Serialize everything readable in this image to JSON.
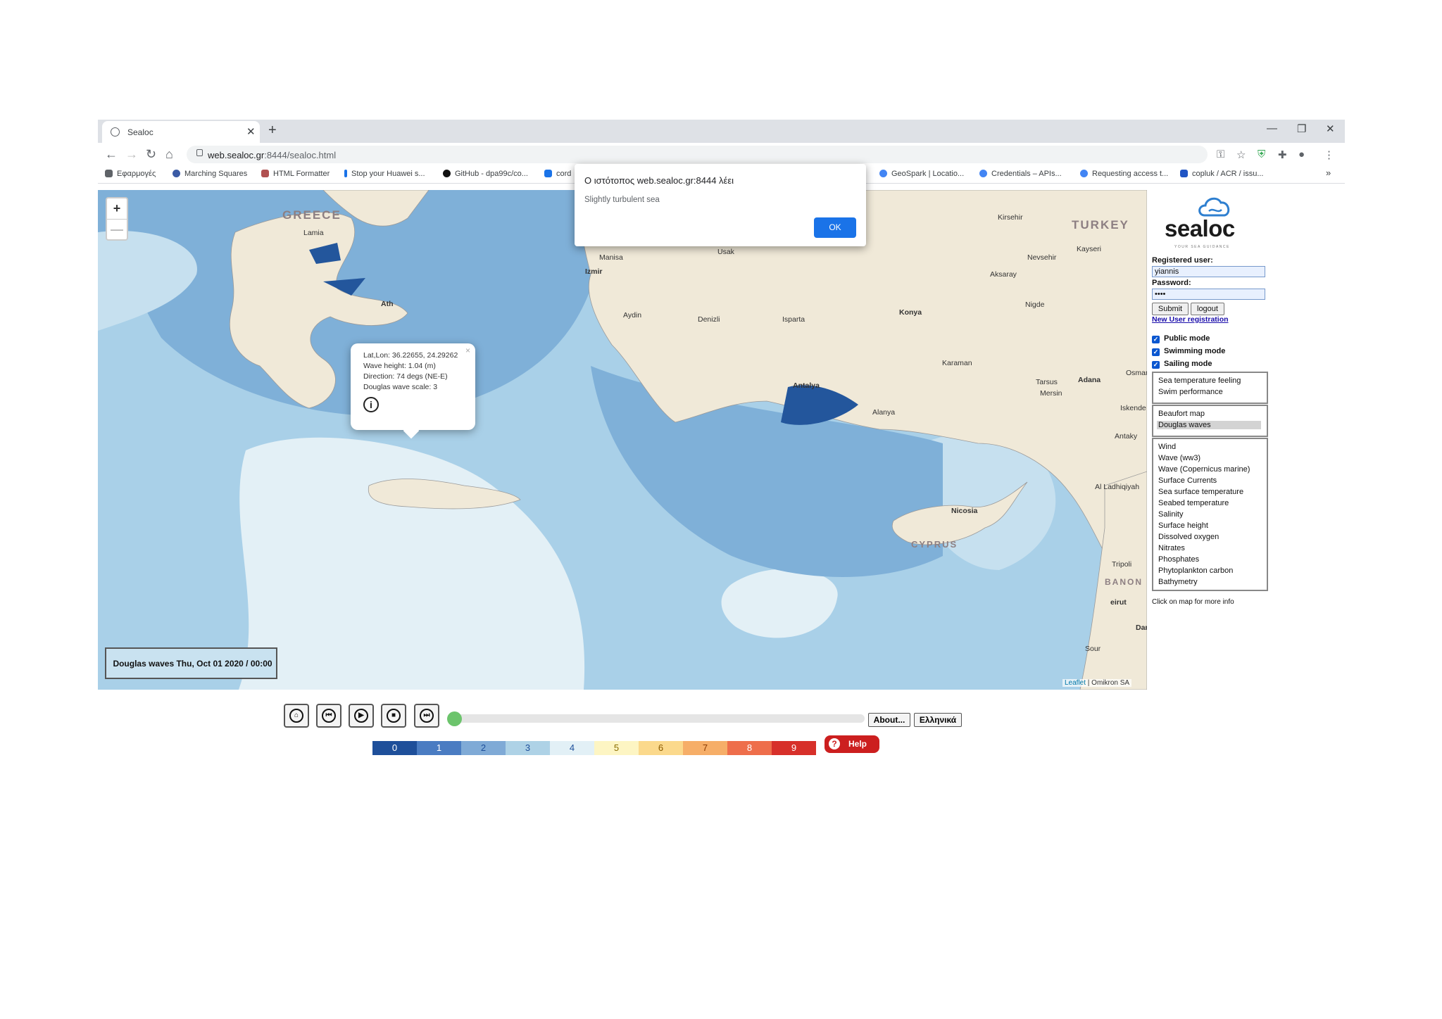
{
  "browser": {
    "tab_title": "Sealoc",
    "url_host": "web.sealoc.gr",
    "url_path": ":8444/sealoc.html",
    "bookmarks": [
      {
        "label": "Εφαρμογές",
        "color": "#5f6368"
      },
      {
        "label": "Marching Squares",
        "color": "#3b5ba5"
      },
      {
        "label": "HTML Formatter",
        "color": "#b05050"
      },
      {
        "label": "Stop your Huawei s...",
        "color": "#1a73e8"
      },
      {
        "label": "GitHub - dpa99c/co...",
        "color": "#111111"
      },
      {
        "label": "cord",
        "color": "#1a73e8"
      },
      {
        "label": "GeoSpark | Locatio...",
        "color": "#4285f4"
      },
      {
        "label": "Credentials – APIs...",
        "color": "#4285f4"
      },
      {
        "label": "Requesting access t...",
        "color": "#4285f4"
      },
      {
        "label": "copluk / ACR / issu...",
        "color": "#2055c4"
      }
    ]
  },
  "map": {
    "countries": [
      "GREECE",
      "TURKEY",
      "CYPRUS",
      "BANON"
    ],
    "cities": [
      "Lamia",
      "Ath",
      "Manisa",
      "Usak",
      "Izmir",
      "Aydin",
      "Denizli",
      "Isparta",
      "Konya",
      "Kirsehir",
      "Kayseri",
      "Nevsehir",
      "Aksaray",
      "Nigde",
      "Karaman",
      "Antalya",
      "Alanya",
      "Adana",
      "Tarsus",
      "Mersin",
      "Osman",
      "Antaky",
      "Iskende",
      "Al Ladhiqiyah",
      "Nicosia",
      "Tripoli",
      "eirut",
      "Dam",
      "Sour"
    ],
    "popup": {
      "latlon": "Lat,Lon: 36.22655, 24.29262",
      "wave_height": "Wave height: 1.04 (m)",
      "direction": "Direction: 74 degs (NE-E)",
      "douglas": "Douglas wave scale: 3",
      "close": "×"
    },
    "datebox": "Douglas waves Thu, Oct 01 2020 / 00:00",
    "attribution_link": "Leaflet",
    "attribution_rest": " | Omikron SA",
    "zoom_in": "+",
    "zoom_out": "—"
  },
  "panel": {
    "logo": "sealoc",
    "logo_tagline": "YOUR SEA GUIDANCE",
    "user_label": "Registered user:",
    "user_value": "yiannis",
    "password_label": "Password:",
    "password_value": "••••",
    "submit": "Submit",
    "logout": "logout",
    "register_link": "New User registration",
    "modes": [
      "Public mode",
      "Swimming mode",
      "Sailing mode"
    ],
    "list1": [
      "Sea temperature feeling",
      "Swim performance"
    ],
    "list2": [
      "Beaufort map",
      "Douglas waves"
    ],
    "list3": [
      "Wind",
      "Wave (ww3)",
      "Wave (Copernicus marine)",
      "Surface Currents",
      "Sea surface temperature",
      "Seabed temperature",
      "Salinity",
      "Surface height",
      "Dissolved oxygen",
      "Nitrates",
      "Phosphates",
      "Phytoplankton carbon",
      "Bathymetry"
    ],
    "hint": "Click on map for more info"
  },
  "controls": {
    "about": "About...",
    "greek": "Ελληνικά",
    "help": "Help",
    "legend": [
      {
        "value": "0",
        "color": "#1e4f9a",
        "text": "#ffffff"
      },
      {
        "value": "1",
        "color": "#4a7cc2",
        "text": "#ffffff"
      },
      {
        "value": "2",
        "color": "#7faad6",
        "text": "#1e4f9a"
      },
      {
        "value": "3",
        "color": "#aed2e6",
        "text": "#1e4f9a"
      },
      {
        "value": "4",
        "color": "#e2f0f6",
        "text": "#1e4f9a"
      },
      {
        "value": "5",
        "color": "#fdf5c3",
        "text": "#8a6d00"
      },
      {
        "value": "6",
        "color": "#fbd98c",
        "text": "#8a5a00"
      },
      {
        "value": "7",
        "color": "#f6ae68",
        "text": "#8a3a00"
      },
      {
        "value": "8",
        "color": "#ee6e4b",
        "text": "#ffffff"
      },
      {
        "value": "9",
        "color": "#d7302a",
        "text": "#ffffff"
      }
    ]
  },
  "dialog": {
    "title": "Ο ιστότοπος web.sealoc.gr:8444 λέει",
    "message": "Slightly turbulent sea",
    "ok": "OK"
  }
}
